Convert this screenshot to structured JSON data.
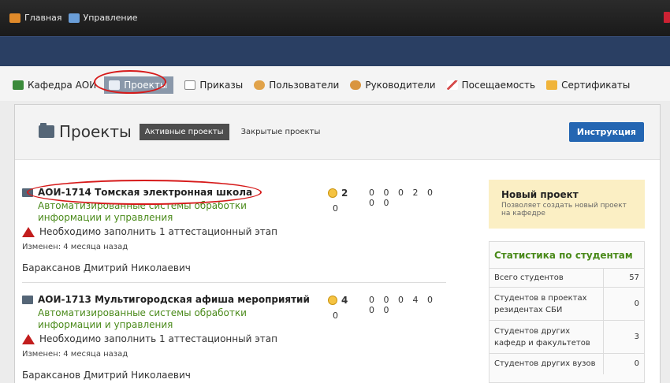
{
  "topbar": {
    "nav": [
      {
        "label": "Главная",
        "icon": "home-icon"
      },
      {
        "label": "Управление",
        "icon": "settings-icon"
      }
    ]
  },
  "menu": {
    "items": [
      {
        "label": "Кафедра АОИ",
        "icon": "department-icon",
        "active": false
      },
      {
        "label": "Проекты",
        "icon": "folder-icon",
        "active": true
      },
      {
        "label": "Приказы",
        "icon": "document-icon",
        "active": false
      },
      {
        "label": "Пользователи",
        "icon": "users-icon",
        "active": false
      },
      {
        "label": "Руководители",
        "icon": "supervisors-icon",
        "active": false
      },
      {
        "label": "Посещаемость",
        "icon": "attendance-chart-icon",
        "active": false
      },
      {
        "label": "Сертификаты",
        "icon": "certificate-icon",
        "active": false
      }
    ]
  },
  "panel": {
    "title": "Проекты",
    "tabs": [
      "Активные проекты",
      "Закрытые проекты"
    ],
    "instruction_button": "Инструкция"
  },
  "projects": [
    {
      "title": "АОИ-1714 Томская электронная школа",
      "category": "Автоматизированные системы обработки информации и управления",
      "warning": "Необходимо заполнить 1 аттестационный этап",
      "changed": "Изменен: 4 месяца назад",
      "author": "Бараксанов Дмитрий Николаевич",
      "smile_count": "2",
      "zero_count": "0",
      "numbers": "0 0 0 2 0 0 0"
    },
    {
      "title": "АОИ-1713 Мультигородская афиша мероприятий",
      "category": "Автоматизированные системы обработки информации и управления",
      "warning": "Необходимо заполнить 1 аттестационный этап",
      "changed": "Изменен: 4 месяца назад",
      "author": "Бараксанов Дмитрий Николаевич",
      "smile_count": "4",
      "zero_count": "0",
      "numbers": "0 0 0 4 0 0 0"
    }
  ],
  "new_project": {
    "title": "Новый проект",
    "description": "Позволяет создать новый проект на кафедре"
  },
  "stats": {
    "title": "Статистика по студентам",
    "rows": [
      {
        "label": "Всего студентов",
        "value": "57"
      },
      {
        "label": "Студентов в проектах резидентах СБИ",
        "value": "0"
      },
      {
        "label": "Студентов других кафедр и факультетов",
        "value": "3"
      },
      {
        "label": "Студентов других вузов",
        "value": "0"
      }
    ]
  },
  "colors": {
    "accent_blue": "#2466b2",
    "header_blue": "#2a3f63",
    "category_green": "#4a8a1a",
    "highlight_red": "#d61a1a"
  }
}
